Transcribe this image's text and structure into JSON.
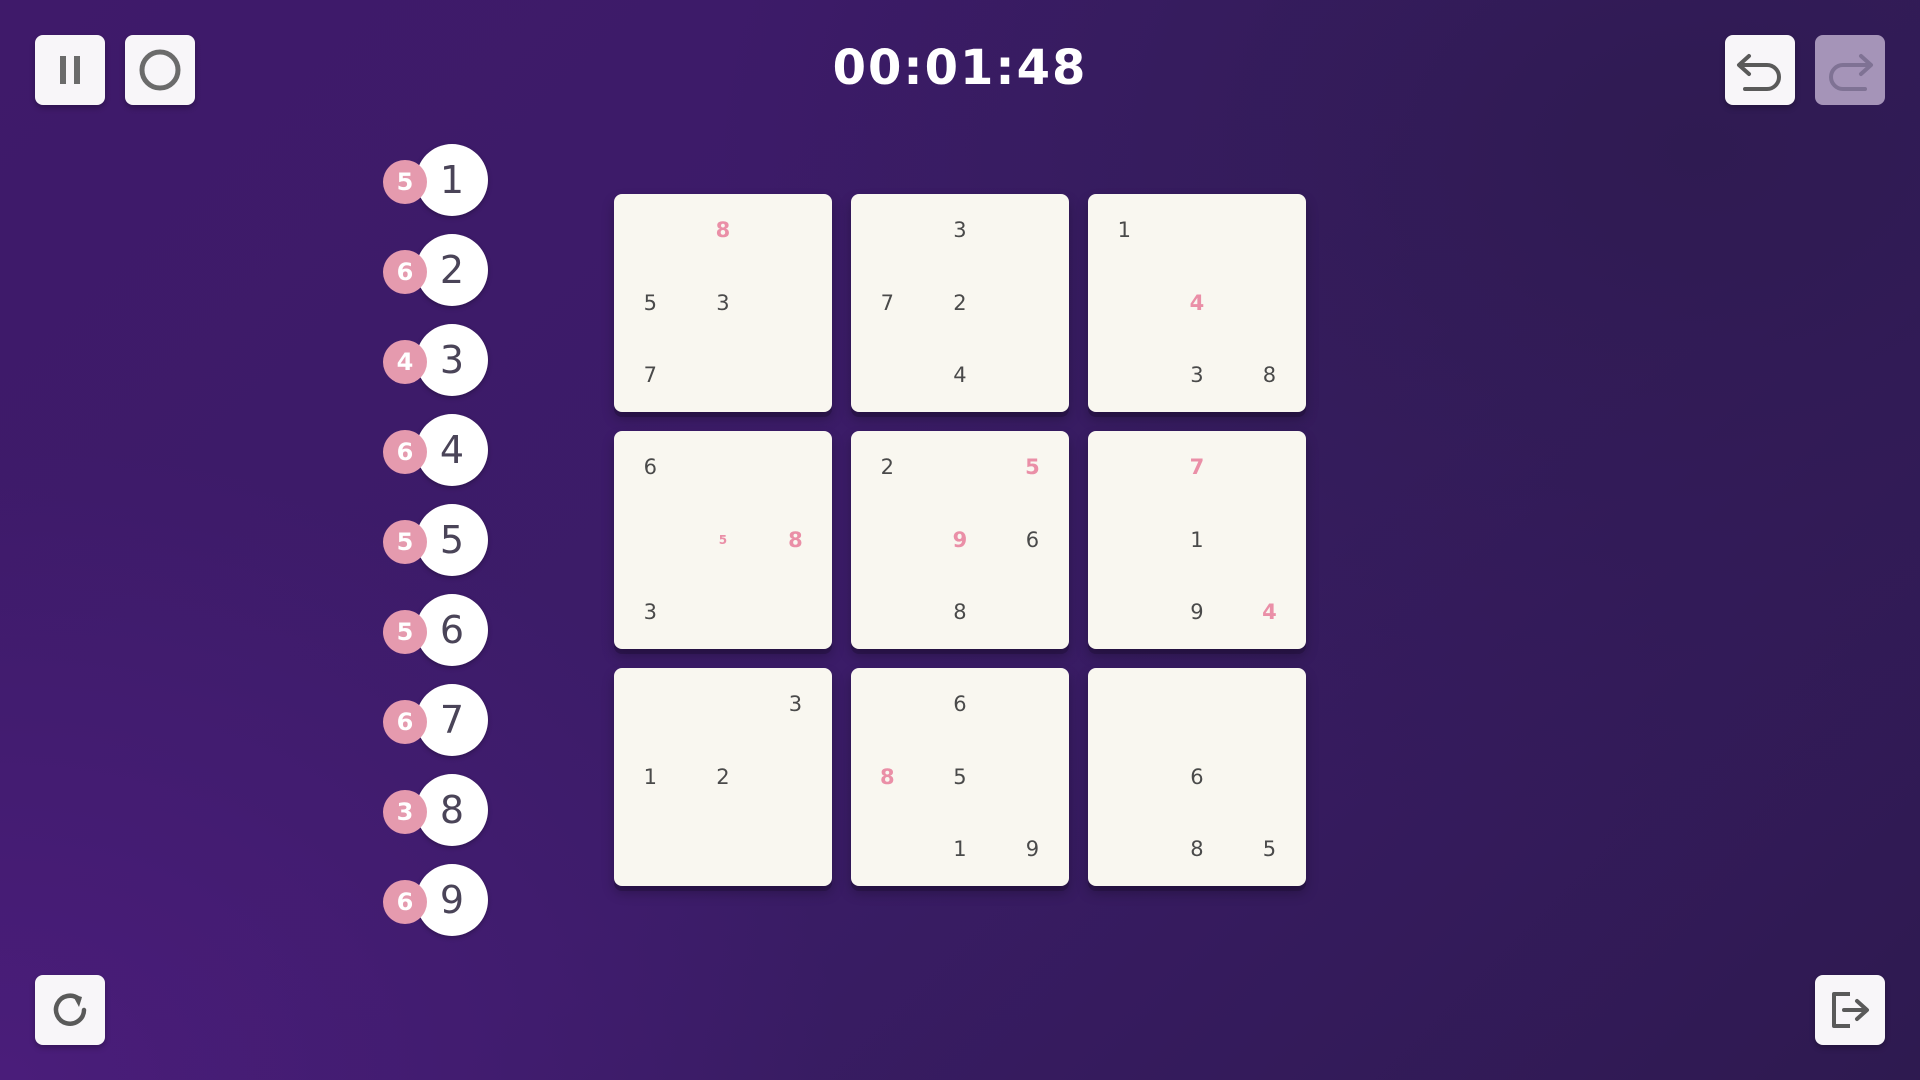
{
  "toolbar": {
    "pause_icon": "pause-icon",
    "hint_icon": "circle-icon",
    "undo_icon": "undo-icon",
    "redo_icon": "redo-icon",
    "restart_icon": "restart-icon",
    "exit_icon": "exit-icon"
  },
  "timer": "00:01:48",
  "number_pad": [
    {
      "digit": "1",
      "remaining": "5"
    },
    {
      "digit": "2",
      "remaining": "6"
    },
    {
      "digit": "3",
      "remaining": "4"
    },
    {
      "digit": "4",
      "remaining": "6"
    },
    {
      "digit": "5",
      "remaining": "5"
    },
    {
      "digit": "6",
      "remaining": "5"
    },
    {
      "digit": "7",
      "remaining": "6"
    },
    {
      "digit": "8",
      "remaining": "3"
    },
    {
      "digit": "9",
      "remaining": "6"
    }
  ],
  "board": {
    "boxes": [
      {
        "cells": [
          {
            "r": 0,
            "c": 1,
            "v": "8",
            "style": "pink"
          },
          {
            "r": 1,
            "c": 0,
            "v": "5",
            "style": "normal"
          },
          {
            "r": 1,
            "c": 1,
            "v": "3",
            "style": "normal"
          },
          {
            "r": 2,
            "c": 0,
            "v": "7",
            "style": "normal"
          }
        ]
      },
      {
        "cells": [
          {
            "r": 0,
            "c": 1,
            "v": "3",
            "style": "normal"
          },
          {
            "r": 1,
            "c": 0,
            "v": "7",
            "style": "normal"
          },
          {
            "r": 1,
            "c": 1,
            "v": "2",
            "style": "normal"
          },
          {
            "r": 2,
            "c": 1,
            "v": "4",
            "style": "normal"
          }
        ]
      },
      {
        "cells": [
          {
            "r": 0,
            "c": 0,
            "v": "1",
            "style": "normal"
          },
          {
            "r": 1,
            "c": 1,
            "v": "4",
            "style": "pink"
          },
          {
            "r": 2,
            "c": 1,
            "v": "3",
            "style": "normal"
          },
          {
            "r": 2,
            "c": 2,
            "v": "8",
            "style": "normal"
          }
        ]
      },
      {
        "cells": [
          {
            "r": 0,
            "c": 0,
            "v": "6",
            "style": "normal"
          },
          {
            "r": 1,
            "c": 1,
            "v": "5",
            "style": "pink-small"
          },
          {
            "r": 1,
            "c": 2,
            "v": "8",
            "style": "pink"
          },
          {
            "r": 2,
            "c": 0,
            "v": "3",
            "style": "normal"
          }
        ]
      },
      {
        "cells": [
          {
            "r": 0,
            "c": 0,
            "v": "2",
            "style": "normal"
          },
          {
            "r": 0,
            "c": 2,
            "v": "5",
            "style": "pink"
          },
          {
            "r": 1,
            "c": 1,
            "v": "9",
            "style": "pink"
          },
          {
            "r": 1,
            "c": 2,
            "v": "6",
            "style": "normal"
          },
          {
            "r": 2,
            "c": 1,
            "v": "8",
            "style": "normal"
          }
        ]
      },
      {
        "cells": [
          {
            "r": 0,
            "c": 1,
            "v": "7",
            "style": "pink"
          },
          {
            "r": 1,
            "c": 1,
            "v": "1",
            "style": "normal"
          },
          {
            "r": 2,
            "c": 1,
            "v": "9",
            "style": "normal"
          },
          {
            "r": 2,
            "c": 2,
            "v": "4",
            "style": "pink"
          }
        ]
      },
      {
        "cells": [
          {
            "r": 0,
            "c": 2,
            "v": "3",
            "style": "normal"
          },
          {
            "r": 1,
            "c": 0,
            "v": "1",
            "style": "normal"
          },
          {
            "r": 1,
            "c": 1,
            "v": "2",
            "style": "normal"
          }
        ]
      },
      {
        "cells": [
          {
            "r": 0,
            "c": 1,
            "v": "6",
            "style": "normal"
          },
          {
            "r": 1,
            "c": 0,
            "v": "8",
            "style": "pink"
          },
          {
            "r": 1,
            "c": 1,
            "v": "5",
            "style": "normal"
          },
          {
            "r": 2,
            "c": 1,
            "v": "1",
            "style": "normal"
          },
          {
            "r": 2,
            "c": 2,
            "v": "9",
            "style": "normal"
          }
        ]
      },
      {
        "cells": [
          {
            "r": 1,
            "c": 1,
            "v": "6",
            "style": "normal"
          },
          {
            "r": 2,
            "c": 1,
            "v": "8",
            "style": "normal"
          },
          {
            "r": 2,
            "c": 2,
            "v": "5",
            "style": "normal"
          }
        ]
      }
    ]
  },
  "colors": {
    "accent_pink": "#ea8fa7",
    "badge_pink": "#e59aae",
    "tile": "#f9f7f0",
    "background": "#3b1c68"
  }
}
